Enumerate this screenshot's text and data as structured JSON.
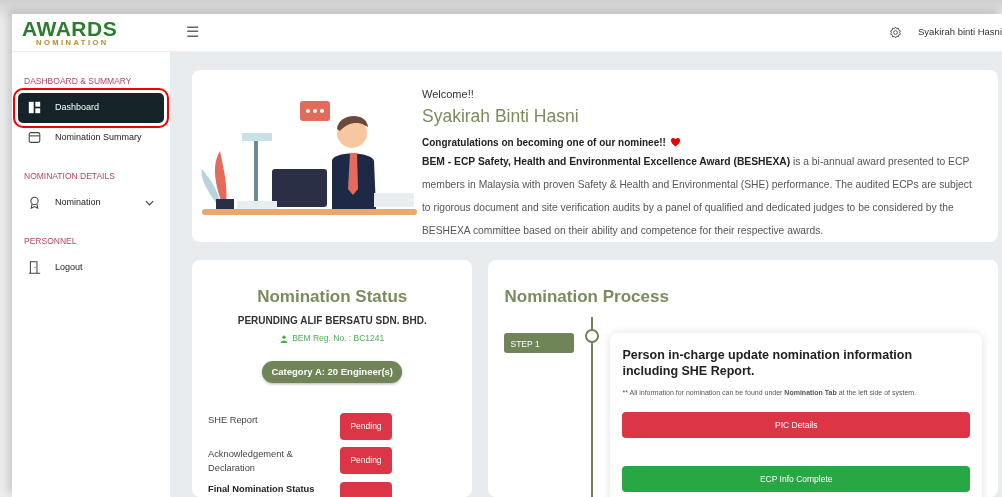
{
  "topbar": {
    "logo_main": "AWARDS",
    "logo_sub": "NOMINATION",
    "menu_icon": "☰",
    "user_name": "Syakirah binti Hasni"
  },
  "sidebar": {
    "sections": [
      {
        "heading": "DASHBOARD & SUMMARY",
        "items": [
          {
            "label": "Dashboard",
            "selected": true,
            "highlighted": true,
            "expandable": false
          },
          {
            "label": "Nomination Summary",
            "selected": false,
            "highlighted": false,
            "expandable": false
          }
        ]
      },
      {
        "heading": "NOMINATION DETAILS",
        "items": [
          {
            "label": "Nomination",
            "selected": false,
            "highlighted": false,
            "expandable": true
          }
        ]
      },
      {
        "heading": "PERSONNEL",
        "items": [
          {
            "label": "Logout",
            "selected": false,
            "highlighted": false,
            "expandable": false
          }
        ]
      }
    ]
  },
  "welcome": {
    "greeting": "Welcome!!",
    "name": "Syakirah Binti Hasni",
    "congrats": "Congratulations on becoming one of our nominee!!",
    "body": "**BEM - ECP Safety, Health and Environmental Excellence Award (BESHEXA)** is a bi-annual award presented to ECP members in Malaysia with proven Safety & Health and Environmental (SHE) performance. The audited ECPs are subject to rigorous document and site verification audits by a panel of qualified and dedicated judges to be considered by the BESHEXA committee based on their ability and competence for their respective awards."
  },
  "nomination_status": {
    "title": "Nomination Status",
    "company": "PERUNDING ALIF BERSATU SDN. BHD.",
    "reg_no": "BEM Reg. No. : BC1241",
    "category": "Category A:  20 Engineer(s)",
    "rows": [
      {
        "label": "SHE Report",
        "status": "Pending",
        "kind": "pending",
        "bold": false
      },
      {
        "label": "Acknowledgement & Declaration",
        "status": "Pending",
        "kind": "pending",
        "bold": false
      },
      {
        "label": "Final Nomination Status",
        "kind": "pending",
        "bold": true
      }
    ]
  },
  "nomination_process": {
    "title": "Nomination Process",
    "steps": [
      {
        "step": "STEP 1",
        "title": "Person in-charge update nomination information including SHE Report.",
        "note": "** All information for nomination can be found under **Nomination Tab** at the left side of system.",
        "buttons": [
          {
            "label": "PIC Details",
            "kind": "pending"
          },
          {
            "label": "ECP Info Complete",
            "kind": "complete"
          }
        ]
      }
    ]
  }
}
